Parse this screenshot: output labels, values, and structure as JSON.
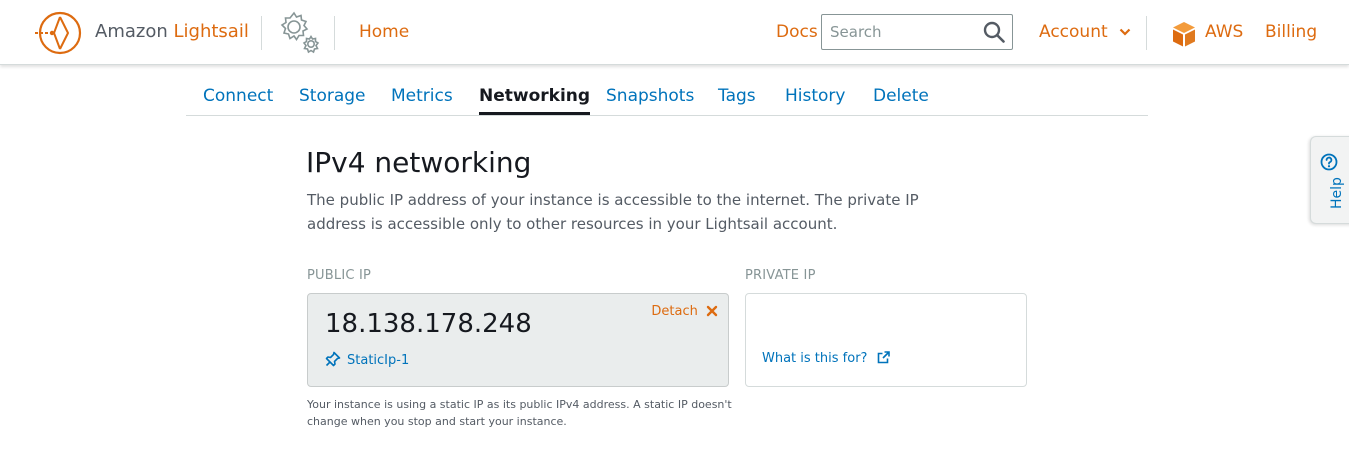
{
  "header": {
    "brand_prefix": "Amazon",
    "brand_strong": "Lightsail",
    "home_label": "Home",
    "docs_label": "Docs",
    "search_placeholder": "Search",
    "account_label": "Account",
    "aws_label": "AWS",
    "billing_label": "Billing"
  },
  "tabs": [
    {
      "label": "Connect",
      "active": false
    },
    {
      "label": "Storage",
      "active": false
    },
    {
      "label": "Metrics",
      "active": false
    },
    {
      "label": "Networking",
      "active": true
    },
    {
      "label": "Snapshots",
      "active": false
    },
    {
      "label": "Tags",
      "active": false
    },
    {
      "label": "History",
      "active": false
    },
    {
      "label": "Delete",
      "active": false
    }
  ],
  "ipv4": {
    "title": "IPv4 networking",
    "description": "The public IP address of your instance is accessible to the internet. The private IP address is accessible only to other resources in your Lightsail account.",
    "public_ip": {
      "label": "PUBLIC IP",
      "value": "18.138.178.248",
      "detach_label": "Detach",
      "static_ip_name": "StaticIp-1"
    },
    "private_ip": {
      "label": "PRIVATE IP",
      "help_link": "What is this for?"
    },
    "footnote": "Your instance is using a static IP as its public IPv4 address. A static IP doesn't change when you stop and start your instance."
  },
  "help_tab": {
    "label": "Help"
  },
  "colors": {
    "accent_orange": "#dd6b10",
    "link_blue": "#0073bb",
    "card_grey": "#eaeded",
    "text_dark": "#16191f"
  }
}
